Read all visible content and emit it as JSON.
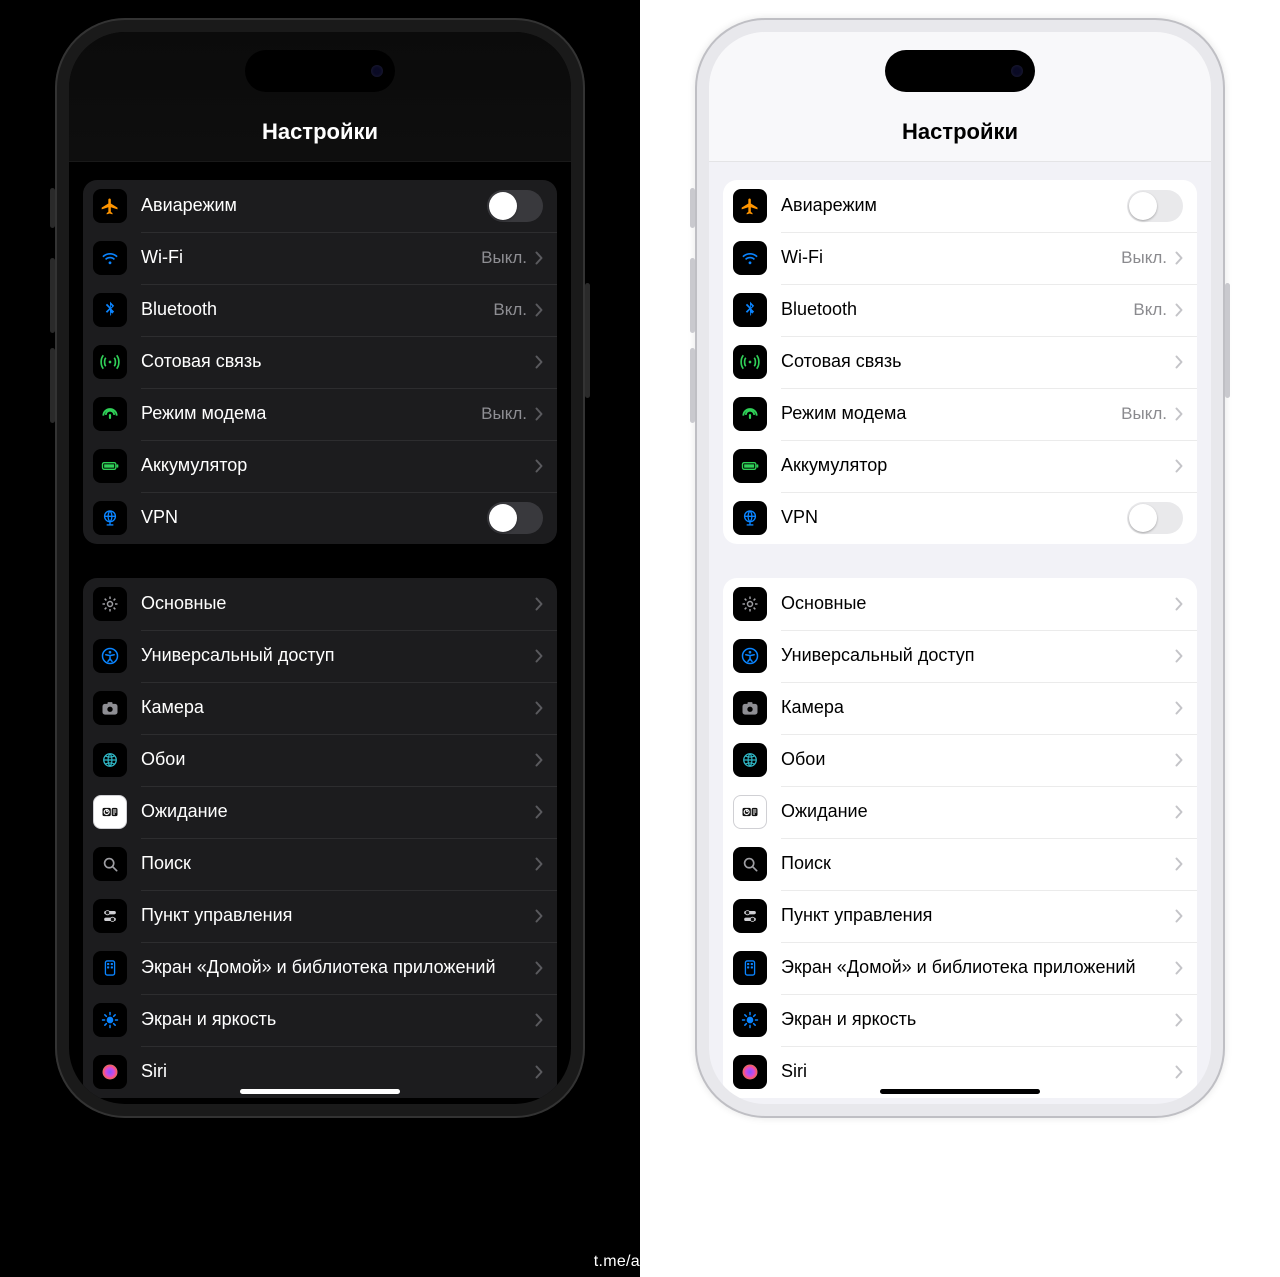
{
  "watermark": "t.me/aaplpro",
  "title": "Настройки",
  "groups": [
    {
      "rows": [
        {
          "icon": "airplane",
          "iconBg": "#000",
          "label": "Авиарежим",
          "kind": "toggle",
          "state": "off"
        },
        {
          "icon": "wifi",
          "iconBg": "#000",
          "label": "Wi-Fi",
          "kind": "link",
          "detail": "Выкл."
        },
        {
          "icon": "bluetooth",
          "iconBg": "#000",
          "label": "Bluetooth",
          "kind": "link",
          "detail": "Вкл."
        },
        {
          "icon": "cellular",
          "iconBg": "#000",
          "label": "Сотовая связь",
          "kind": "link"
        },
        {
          "icon": "hotspot",
          "iconBg": "#000",
          "label": "Режим модема",
          "kind": "link",
          "detail": "Выкл."
        },
        {
          "icon": "battery",
          "iconBg": "#000",
          "label": "Аккумулятор",
          "kind": "link"
        },
        {
          "icon": "vpn",
          "iconBg": "#000",
          "label": "VPN",
          "kind": "toggle",
          "state": "off"
        }
      ]
    },
    {
      "rows": [
        {
          "icon": "general",
          "iconBg": "#000",
          "label": "Основные",
          "kind": "link"
        },
        {
          "icon": "accessibility",
          "iconBg": "#000",
          "label": "Универсальный доступ",
          "kind": "link"
        },
        {
          "icon": "camera",
          "iconBg": "#000",
          "label": "Камера",
          "kind": "link"
        },
        {
          "icon": "wallpaper",
          "iconBg": "#000",
          "label": "Обои",
          "kind": "link"
        },
        {
          "icon": "standby",
          "iconBg": "#fff",
          "label": "Ожидание",
          "kind": "link"
        },
        {
          "icon": "search",
          "iconBg": "#000",
          "label": "Поиск",
          "kind": "link"
        },
        {
          "icon": "control",
          "iconBg": "#000",
          "label": "Пункт управления",
          "kind": "link"
        },
        {
          "icon": "homescreen",
          "iconBg": "#000",
          "label": "Экран «Домой» и библиотека приложений",
          "kind": "link"
        },
        {
          "icon": "display",
          "iconBg": "#000",
          "label": "Экран и яркость",
          "kind": "link"
        },
        {
          "icon": "siri",
          "iconBg": "#000",
          "label": "Siri",
          "kind": "link"
        }
      ]
    }
  ]
}
